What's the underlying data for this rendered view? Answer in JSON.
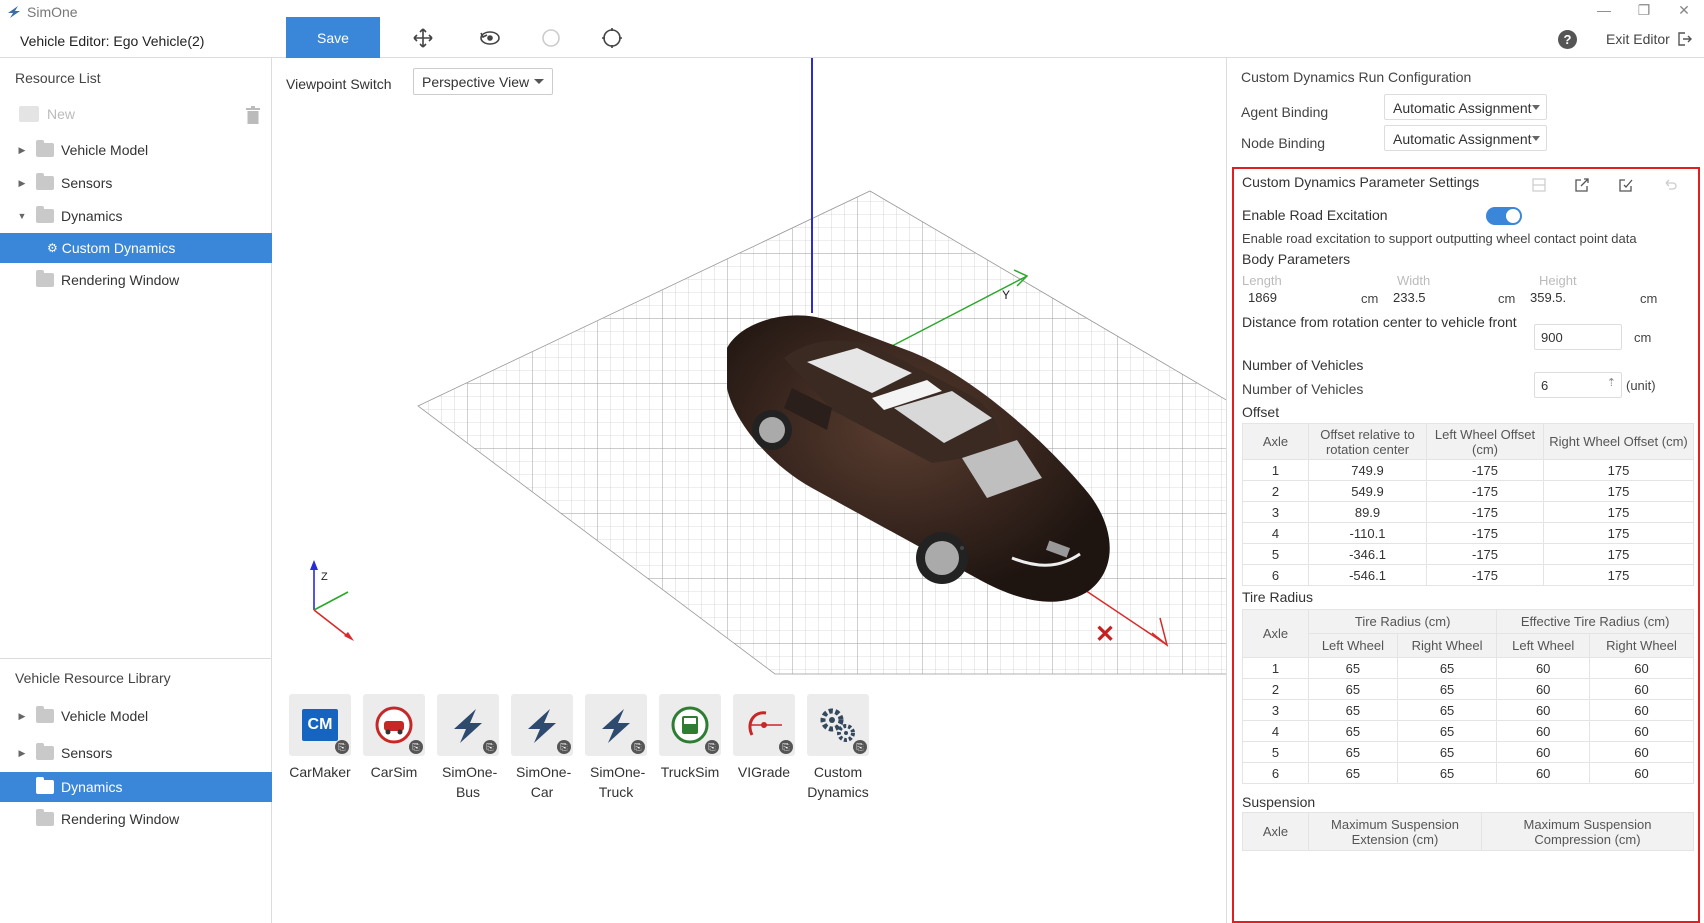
{
  "app": {
    "name": "SimOne",
    "editor_title": "Vehicle Editor: Ego Vehicle(2)"
  },
  "toolbar": {
    "save_label": "Save",
    "exit_label": "Exit Editor"
  },
  "resource_list": {
    "title": "Resource List",
    "new_label": "New",
    "items": [
      {
        "label": "Vehicle Model"
      },
      {
        "label": "Sensors"
      },
      {
        "label": "Dynamics"
      },
      {
        "label": "Custom Dynamics"
      },
      {
        "label": "Rendering Window"
      }
    ]
  },
  "vehicle_library": {
    "title": "Vehicle Resource Library",
    "items": [
      {
        "label": "Vehicle Model"
      },
      {
        "label": "Sensors"
      },
      {
        "label": "Dynamics"
      },
      {
        "label": "Rendering Window"
      }
    ]
  },
  "viewport": {
    "label": "Viewpoint Switch",
    "selected": "Perspective View",
    "axis_z": "Z"
  },
  "dynamics_library": [
    {
      "label": "CarMaker",
      "icon": "carmaker-icon",
      "icon_text": "CM"
    },
    {
      "label": "CarSim",
      "icon": "carsim-icon"
    },
    {
      "label": "SimOne-Bus",
      "icon": "simone-bus-icon"
    },
    {
      "label": "SimOne-Car",
      "icon": "simone-car-icon"
    },
    {
      "label": "SimOne-Truck",
      "icon": "simone-truck-icon"
    },
    {
      "label": "TruckSim",
      "icon": "trucksim-icon"
    },
    {
      "label": "VIGrade",
      "icon": "vigrade-icon"
    },
    {
      "label": "Custom Dynamics",
      "icon": "gears-icon"
    }
  ],
  "run_config": {
    "title": "Custom Dynamics Run Configuration",
    "agent_binding_label": "Agent Binding",
    "agent_binding_value": "Automatic Assignment",
    "node_binding_label": "Node Binding",
    "node_binding_value": "Automatic Assignment"
  },
  "params": {
    "title": "Custom Dynamics Parameter Settings",
    "road_excitation_label": "Enable Road Excitation",
    "road_excitation_on": true,
    "road_excitation_desc": "Enable road excitation to support outputting wheel contact point data",
    "body_params_label": "Body Parameters",
    "length_label": "Length",
    "width_label": "Width",
    "height_label": "Height",
    "length": "1869",
    "width": "233.5",
    "height": "359.5.",
    "unit_cm": "cm",
    "rotation_label": "Distance from rotation center to vehicle front",
    "rotation_value": "900",
    "num_vehicles_label": "Number of Vehicles",
    "num_vehicles_field_label": "Number of Vehicles",
    "num_vehicles": "6",
    "unit_label": "(unit)",
    "offset_label": "Offset",
    "offset_headers": [
      "Axle",
      "Offset relative to rotation center",
      "Left Wheel Offset (cm)",
      "Right Wheel Offset (cm)"
    ],
    "offset_rows": [
      [
        "1",
        "749.9",
        "-175",
        "175"
      ],
      [
        "2",
        "549.9",
        "-175",
        "175"
      ],
      [
        "3",
        "89.9",
        "-175",
        "175"
      ],
      [
        "4",
        "-110.1",
        "-175",
        "175"
      ],
      [
        "5",
        "-346.1",
        "-175",
        "175"
      ],
      [
        "6",
        "-546.1",
        "-175",
        "175"
      ]
    ],
    "tire_label": "Tire Radius",
    "tire_headers": {
      "axle": "Axle",
      "group1": "Tire Radius (cm)",
      "group2": "Effective Tire Radius (cm)",
      "left": "Left Wheel",
      "right": "Right Wheel"
    },
    "tire_rows": [
      [
        "1",
        "65",
        "65",
        "60",
        "60"
      ],
      [
        "2",
        "65",
        "65",
        "60",
        "60"
      ],
      [
        "3",
        "65",
        "65",
        "60",
        "60"
      ],
      [
        "4",
        "65",
        "65",
        "60",
        "60"
      ],
      [
        "5",
        "65",
        "65",
        "60",
        "60"
      ],
      [
        "6",
        "65",
        "65",
        "60",
        "60"
      ]
    ],
    "suspension_label": "Suspension",
    "suspension_headers": [
      "Axle",
      "Maximum Suspension Extension (cm)",
      "Maximum Suspension Compression (cm)"
    ]
  },
  "colors": {
    "accent": "#3a86d8",
    "highlight_border": "#e02020"
  }
}
